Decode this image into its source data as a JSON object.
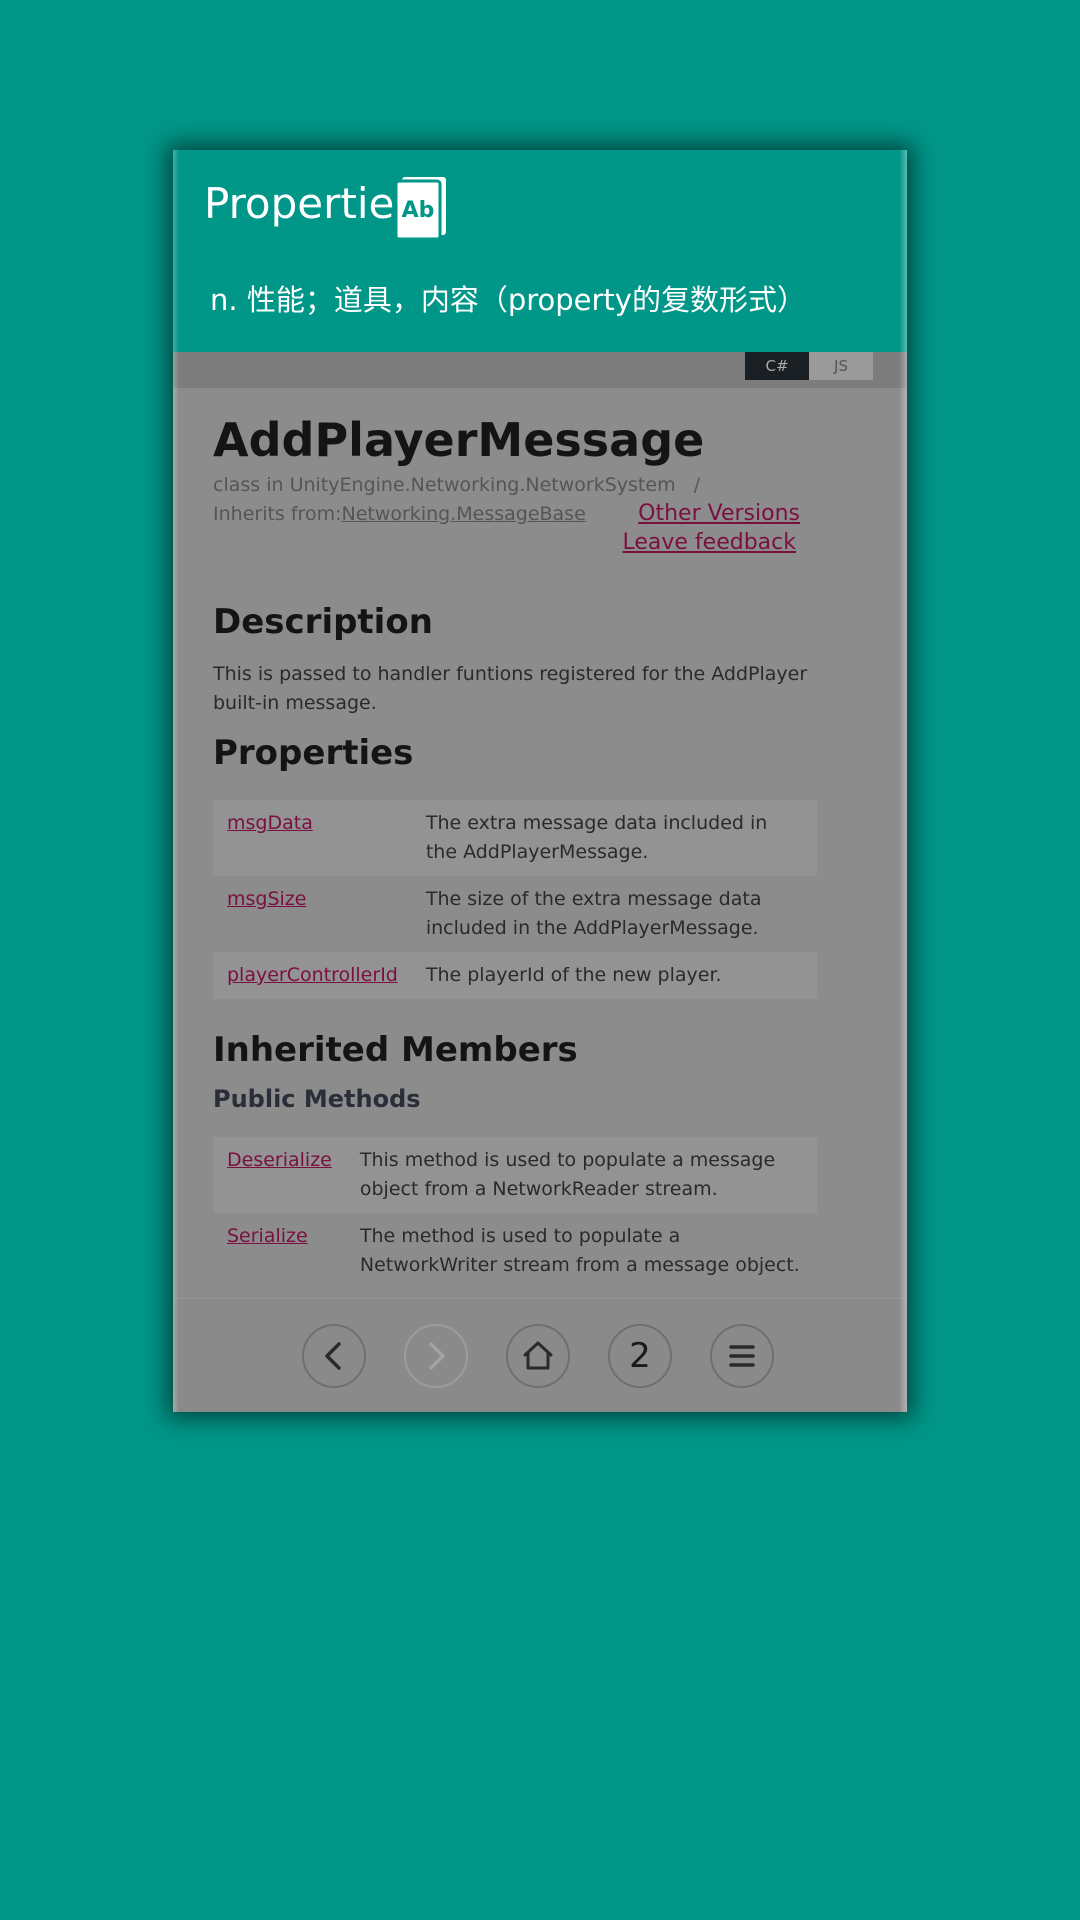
{
  "word_card": {
    "title": "Properties",
    "icon_text": "Ab",
    "definition": "n. 性能；道具，内容（property的复数形式）"
  },
  "language_tabs": {
    "cs": "C#",
    "js": "JS"
  },
  "page": {
    "title": "AddPlayerMessage",
    "class_path": "class in UnityEngine.Networking.NetworkSystem",
    "separator": "/",
    "inherits_label": "Inherits from:",
    "inherits_link": "Networking.MessageBase",
    "other_versions": "Other Versions",
    "leave_feedback": "Leave feedback"
  },
  "description": {
    "heading": "Description",
    "text": "This is passed to handler funtions registered for the AddPlayer built-in message."
  },
  "properties": {
    "heading": "Properties",
    "rows": [
      {
        "name": "msgData",
        "desc": "The extra message data included in the AddPlayerMessage."
      },
      {
        "name": "msgSize",
        "desc": "The size of the extra message data included in the AddPlayerMessage."
      },
      {
        "name": "playerControllerId",
        "desc": "The playerId of the new player."
      }
    ]
  },
  "inherited": {
    "heading": "Inherited Members",
    "subheading": "Public Methods",
    "rows": [
      {
        "name": "Deserialize",
        "desc": "This method is used to populate a message object from a NetworkReader stream."
      },
      {
        "name": "Serialize",
        "desc": "The method is used to populate a NetworkWriter stream from a message object."
      }
    ]
  },
  "nav": {
    "tab_count": "2",
    "forward_enabled": false
  }
}
